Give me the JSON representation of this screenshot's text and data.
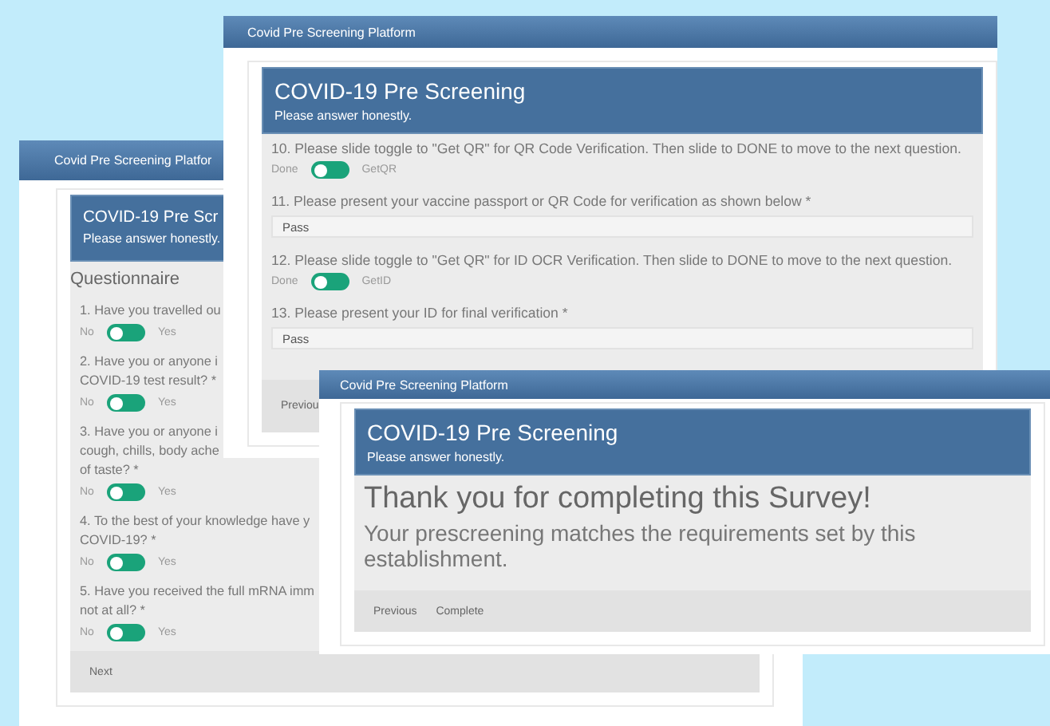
{
  "windows": [
    {
      "title": "Covid Pre Screening Platfor",
      "heading": "COVID-19 Pre Scr",
      "subheading": "Please answer honestly.",
      "items": [
        {
          "kind": "section",
          "text": "Questionnaire"
        },
        {
          "kind": "toggle",
          "lines": [
            "1. Have you travelled ou"
          ],
          "off_label": "No",
          "on_label": "Yes",
          "on": false
        },
        {
          "kind": "toggle",
          "lines": [
            "2. Have you or anyone i",
            "COVID-19 test result? *"
          ],
          "off_label": "No",
          "on_label": "Yes",
          "on": false
        },
        {
          "kind": "toggle",
          "lines": [
            "3. Have you or anyone i",
            "cough, chills, body ache",
            "of taste? *"
          ],
          "off_label": "No",
          "on_label": "Yes",
          "on": false
        },
        {
          "kind": "toggle",
          "lines": [
            "4. To the best of your knowledge have y",
            "COVID-19? *"
          ],
          "off_label": "No",
          "on_label": "Yes",
          "on": false
        },
        {
          "kind": "toggle",
          "lines": [
            "5. Have you received the full mRNA imm",
            "not at all? *"
          ],
          "off_label": "No",
          "on_label": "Yes",
          "on": false
        }
      ],
      "buttons": [
        "Next"
      ]
    },
    {
      "title": "Covid Pre Screening Platform",
      "heading": "COVID-19 Pre Screening",
      "subheading": "Please answer honestly.",
      "items": [
        {
          "kind": "toggle",
          "lines": [
            "10. Please slide toggle to \"Get QR\"  for QR Code Verification. Then slide to DONE to move to the next question."
          ],
          "off_label": "Done",
          "on_label": "GetQR",
          "on": false
        },
        {
          "kind": "field",
          "lines": [
            "11. Please present your vaccine passport or QR Code for verification as shown below *"
          ],
          "value": "Pass"
        },
        {
          "kind": "toggle",
          "lines": [
            "12. Please slide toggle to \"Get QR\"  for ID OCR Verification. Then slide to DONE to move to the next question."
          ],
          "off_label": "Done",
          "on_label": "GetID",
          "on": false
        },
        {
          "kind": "field",
          "lines": [
            "13. Please present your ID for final verification *"
          ],
          "value": "Pass"
        }
      ],
      "buttons": [
        "Previou"
      ]
    },
    {
      "title": "Covid Pre Screening Platform",
      "heading": "COVID-19 Pre Screening",
      "subheading": "Please answer honestly.",
      "items": [
        {
          "kind": "message",
          "title": "Thank you for completing this Survey!",
          "text": "Your prescreening matches the requirements set by this establishment."
        }
      ],
      "buttons": [
        "Previous",
        "Complete"
      ]
    }
  ]
}
